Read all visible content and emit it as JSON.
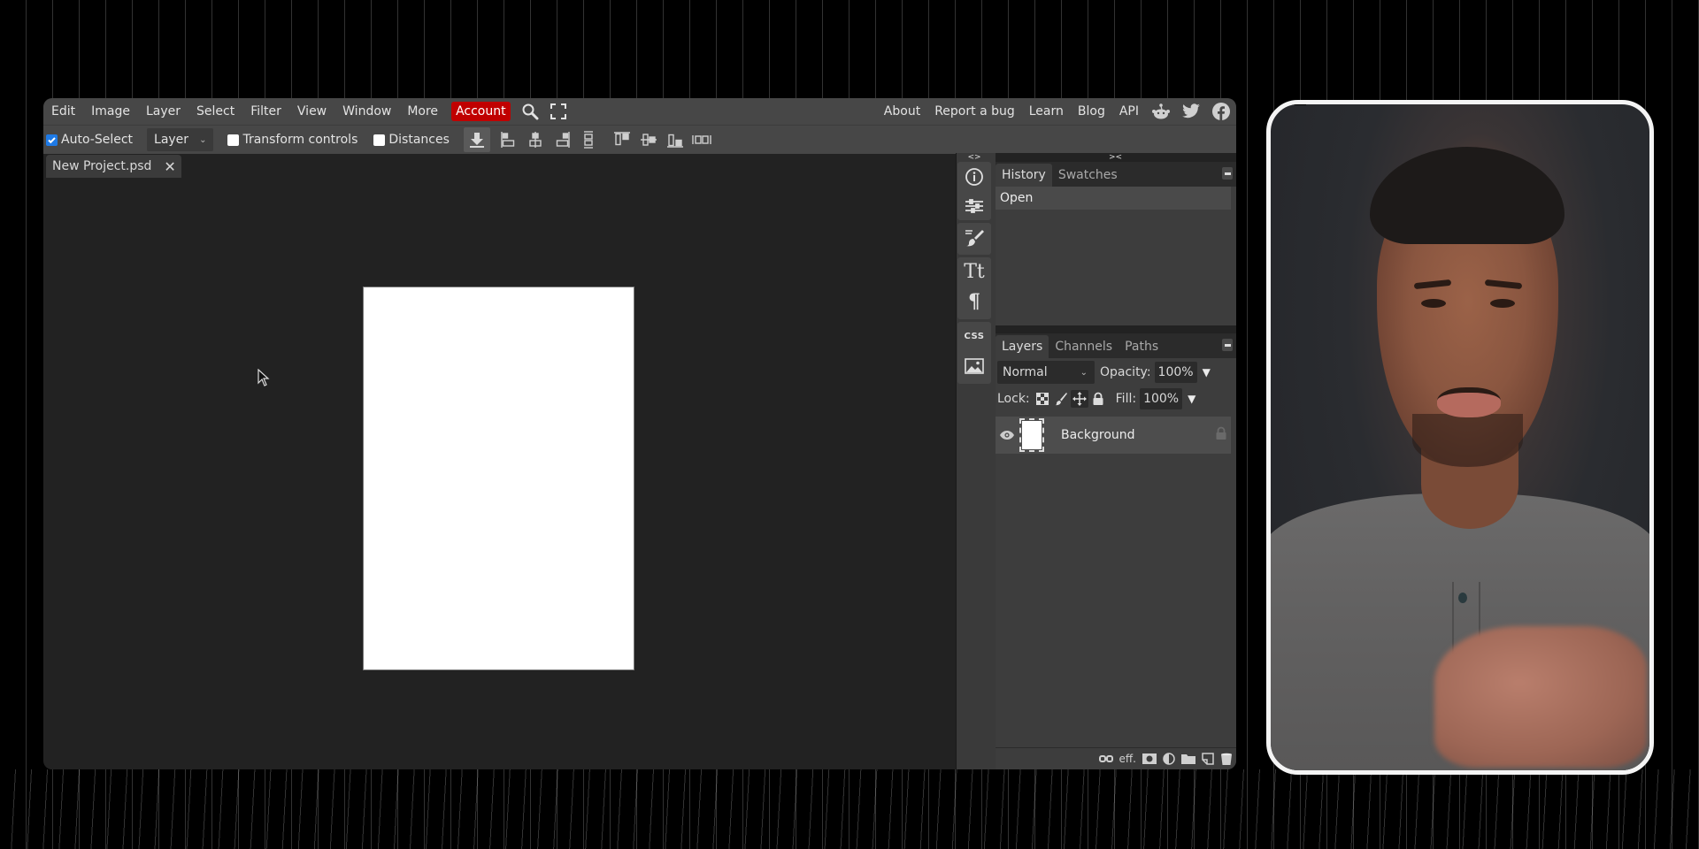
{
  "menubar": {
    "items": [
      "Edit",
      "Image",
      "Layer",
      "Select",
      "Filter",
      "View",
      "Window",
      "More"
    ],
    "account": "Account",
    "right_links": [
      "About",
      "Report a bug",
      "Learn",
      "Blog",
      "API"
    ],
    "icons": [
      "search-icon",
      "fullscreen-icon",
      "reddit-icon",
      "twitter-icon",
      "facebook-icon"
    ],
    "account_color": "#c00000"
  },
  "toolbar": {
    "auto_select_label": "Auto-Select",
    "auto_select_checked": true,
    "target_select_value": "Layer",
    "transform_controls_label": "Transform controls",
    "transform_controls_checked": false,
    "distances_label": "Distances",
    "distances_checked": false
  },
  "document_tabs": [
    {
      "name": "New Project.psd",
      "close": "✕"
    }
  ],
  "side_column": {
    "collapse_label": "<>",
    "icons": [
      "info-icon",
      "adjustments-icon",
      "brush-settings-icon",
      "character-icon",
      "paragraph-icon",
      "css-icon",
      "image-icon"
    ],
    "css_label": "CSS"
  },
  "panels": {
    "collapse_label": "><",
    "history": {
      "tabs": [
        "History",
        "Swatches"
      ],
      "active_tab": "History",
      "entries": [
        "Open"
      ]
    },
    "layers": {
      "tabs": [
        "Layers",
        "Channels",
        "Paths"
      ],
      "active_tab": "Layers",
      "blend_mode": "Normal",
      "opacity_label": "Opacity:",
      "opacity_value": "100%",
      "lock_label": "Lock:",
      "fill_label": "Fill:",
      "fill_value": "100%",
      "layers": [
        {
          "name": "Background",
          "visible": true,
          "locked": true
        }
      ],
      "footer_icons": [
        "link-icon",
        "effects-icon",
        "mask-icon",
        "adjustment-layer-icon",
        "folder-icon",
        "new-layer-icon",
        "delete-icon"
      ],
      "effects_label": "eff."
    }
  },
  "webcam": {
    "label": "presenter-webcam"
  }
}
